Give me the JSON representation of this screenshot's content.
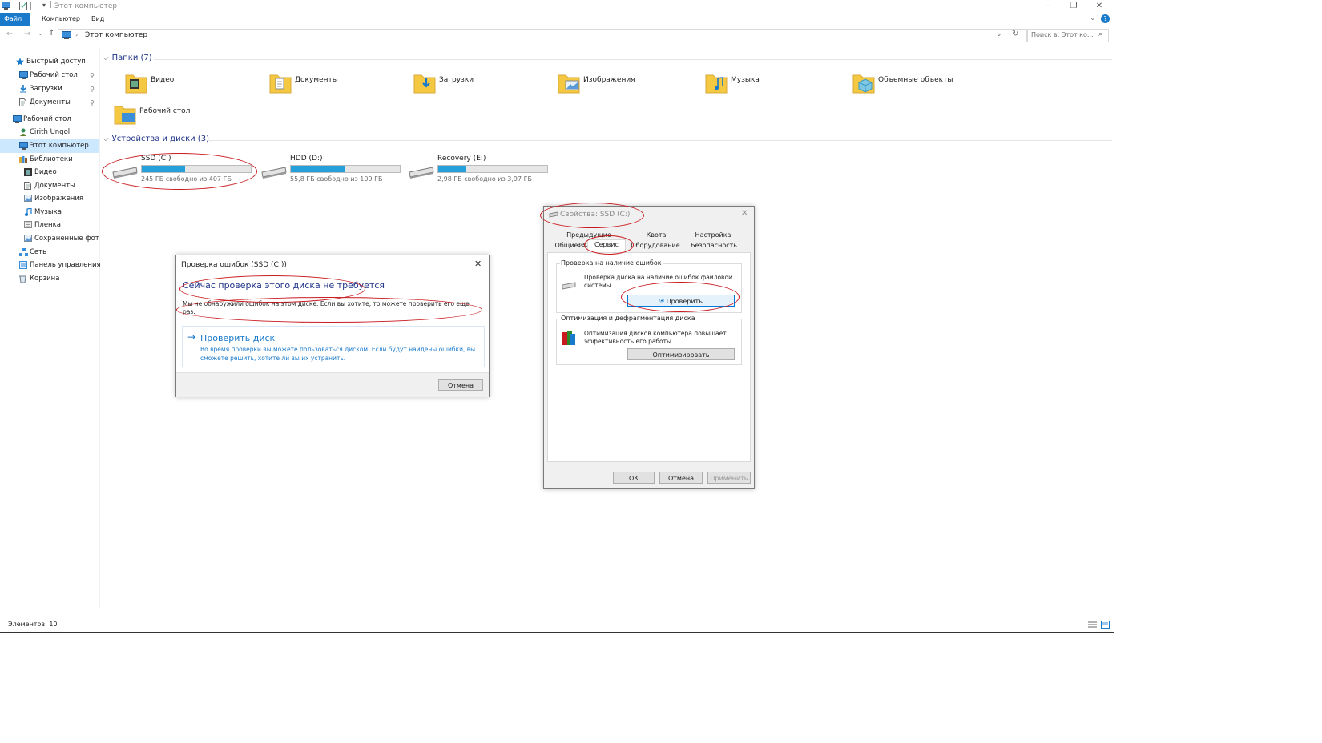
{
  "window": {
    "title": "Этот компьютер",
    "controls": [
      "minimize-icon",
      "restore-icon",
      "close-icon"
    ]
  },
  "ribbon": {
    "tabs": [
      "Файл",
      "Компьютер",
      "Вид"
    ]
  },
  "navbar": {
    "address": "Этот компьютер",
    "search_placeholder": "Поиск в: Этот ко..."
  },
  "navpane": {
    "items": [
      {
        "label": "Быстрый доступ",
        "icon": "star-icon",
        "pinned": false
      },
      {
        "label": "Рабочий стол",
        "icon": "desktop-icon",
        "pinned": true
      },
      {
        "label": "Загрузки",
        "icon": "download-icon",
        "pinned": true
      },
      {
        "label": "Документы",
        "icon": "document-icon",
        "pinned": true
      },
      {
        "label": "Рабочий стол",
        "icon": "desktop-icon",
        "pinned": false
      },
      {
        "label": "Cirith Ungol",
        "icon": "user-icon",
        "pinned": false
      },
      {
        "label": "Этот компьютер",
        "icon": "computer-icon",
        "pinned": false
      },
      {
        "label": "Библиотеки",
        "icon": "library-icon",
        "pinned": false
      },
      {
        "label": "Видео",
        "icon": "video-icon",
        "pinned": false
      },
      {
        "label": "Документы",
        "icon": "document-icon",
        "pinned": false
      },
      {
        "label": "Изображения",
        "icon": "pictures-icon",
        "pinned": false
      },
      {
        "label": "Музыка",
        "icon": "music-icon",
        "pinned": false
      },
      {
        "label": "Пленка",
        "icon": "film-icon",
        "pinned": false
      },
      {
        "label": "Сохраненные фот",
        "icon": "pictures-icon",
        "pinned": false
      },
      {
        "label": "Сеть",
        "icon": "network-icon",
        "pinned": false
      },
      {
        "label": "Панель управления",
        "icon": "control-panel-icon",
        "pinned": false
      },
      {
        "label": "Корзина",
        "icon": "recycle-bin-icon",
        "pinned": false
      }
    ]
  },
  "folders": {
    "header": "Папки (7)",
    "items": [
      "Видео",
      "Документы",
      "Загрузки",
      "Изображения",
      "Музыка",
      "Объемные объекты",
      "Рабочий стол"
    ]
  },
  "drives": {
    "header": "Устройства и диски (3)",
    "items": [
      {
        "name": "SSD (C:)",
        "free": "245 ГБ свободно из 407 ГБ",
        "used_fraction": 0.4
      },
      {
        "name": "HDD (D:)",
        "free": "55,8 ГБ свободно из 109 ГБ",
        "used_fraction": 0.49
      },
      {
        "name": "Recovery (E:)",
        "free": "2,98 ГБ свободно из 3,97 ГБ",
        "used_fraction": 0.25
      }
    ]
  },
  "status": {
    "items_count": "Элементов: 10"
  },
  "check_dialog": {
    "title": "Проверка ошибок (SSD (C:))",
    "heading": "Сейчас проверка этого диска не требуется",
    "message": "Мы не обнаружили ошибок на этом диске. Если вы хотите, то можете проверить его еще раз.",
    "action_title": "Проверить диск",
    "action_desc": "Во время проверки вы можете пользоваться диском. Если будут найдены ошибки, вы сможете решить, хотите ли вы их устранить.",
    "cancel": "Отмена"
  },
  "props_dialog": {
    "title": "Свойства: SSD (C:)",
    "tabs_row1": [
      "Предыдущие версии",
      "Квота",
      "Настройка"
    ],
    "tabs_row2": [
      "Общие",
      "Сервис",
      "Оборудование",
      "Безопасность"
    ],
    "group1_title": "Проверка на наличие ошибок",
    "group1_text": "Проверка диска на наличие ошибок файловой системы.",
    "check_button": "Проверить",
    "group2_title": "Оптимизация и дефрагментация диска",
    "group2_text": "Оптимизация дисков компьютера повышает эффективность его работы.",
    "optimize_button": "Оптимизировать",
    "ok": "ОК",
    "cancel": "Отмена",
    "apply": "Применить"
  },
  "colors": {
    "accent": "#1979ca",
    "bar_fill": "#26a0da",
    "annotation": "#c8191e",
    "folder": "#f5c842"
  }
}
